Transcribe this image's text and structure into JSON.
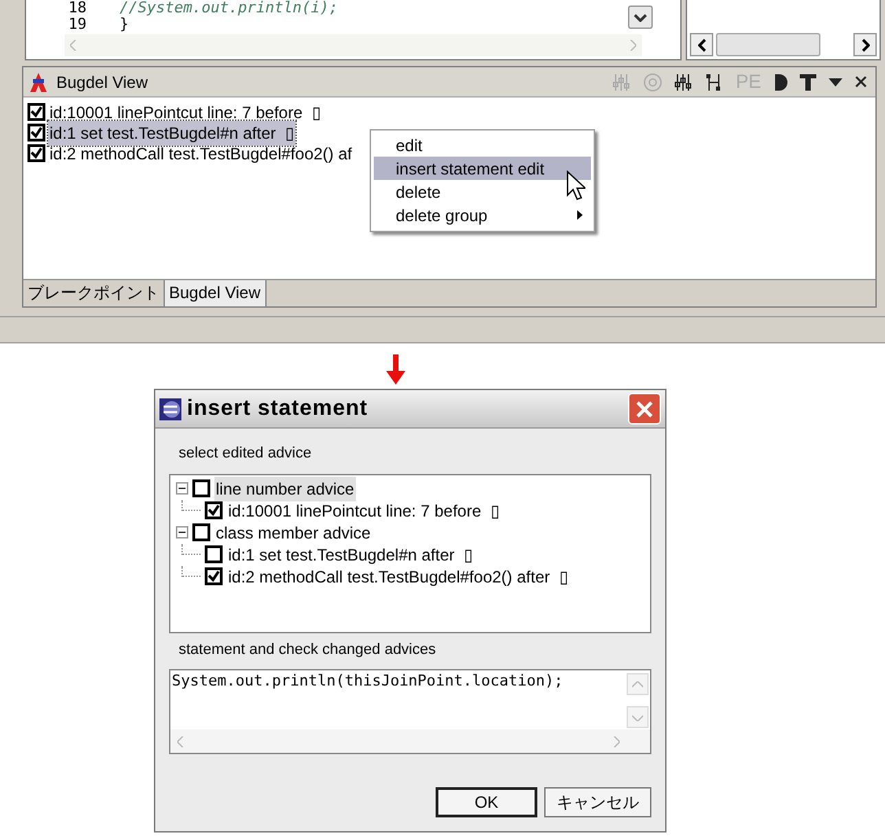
{
  "editor": {
    "lines": [
      {
        "number": "18",
        "code": "//System.out.println(i);",
        "kind": "comment"
      },
      {
        "number": "19",
        "code": "}",
        "kind": "code"
      }
    ]
  },
  "bugdel_view": {
    "title": "Bugdel View",
    "toolbar": [
      {
        "kind": "filter",
        "disabled": true
      },
      {
        "kind": "target",
        "disabled": true
      },
      {
        "kind": "filter",
        "disabled": false
      },
      {
        "kind": "tree",
        "disabled": false
      },
      {
        "kind": "pe",
        "label": "PE",
        "disabled": true
      },
      {
        "kind": "half",
        "disabled": false
      },
      {
        "kind": "t",
        "disabled": false
      },
      {
        "kind": "dropdown",
        "disabled": false
      },
      {
        "kind": "close",
        "disabled": false
      }
    ],
    "items": [
      {
        "label": "id:10001 linePointcut line: 7 before  ▯",
        "checked": true,
        "selected": false
      },
      {
        "label": "id:1 set test.TestBugdel#n after  ▯",
        "checked": true,
        "selected": true
      },
      {
        "label": "id:2 methodCall test.TestBugdel#foo2() af",
        "checked": true,
        "selected": false
      }
    ],
    "tabs": [
      {
        "label": "ブレークポイント",
        "selected": false
      },
      {
        "label": "Bugdel View",
        "selected": true
      }
    ]
  },
  "context_menu": {
    "items": [
      {
        "label": "edit",
        "selected": false,
        "has_submenu": false
      },
      {
        "label": "insert statement edit",
        "selected": true,
        "has_submenu": false
      },
      {
        "label": "delete",
        "selected": false,
        "has_submenu": false
      },
      {
        "label": "delete group",
        "selected": false,
        "has_submenu": true
      }
    ]
  },
  "dialog": {
    "title": "insert statement",
    "tree_label": "select edited advice",
    "tree": [
      {
        "label": "line number advice",
        "checked": false,
        "selected": true,
        "expanded": true,
        "children": [
          {
            "label": "id:10001 linePointcut line: 7 before  ▯",
            "checked": true,
            "selected": false
          }
        ]
      },
      {
        "label": "class member advice",
        "checked": false,
        "selected": false,
        "expanded": true,
        "children": [
          {
            "label": "id:1 set test.TestBugdel#n after  ▯",
            "checked": false,
            "selected": false
          },
          {
            "label": "id:2 methodCall test.TestBugdel#foo2() after  ▯",
            "checked": true,
            "selected": false
          }
        ]
      }
    ],
    "statement_label": "statement  and check changed advices",
    "statement": "System.out.println(thisJoinPoint.location);",
    "buttons": [
      {
        "label": "OK",
        "kind": "default"
      },
      {
        "label": "キャンセル",
        "kind": "normal"
      }
    ]
  }
}
